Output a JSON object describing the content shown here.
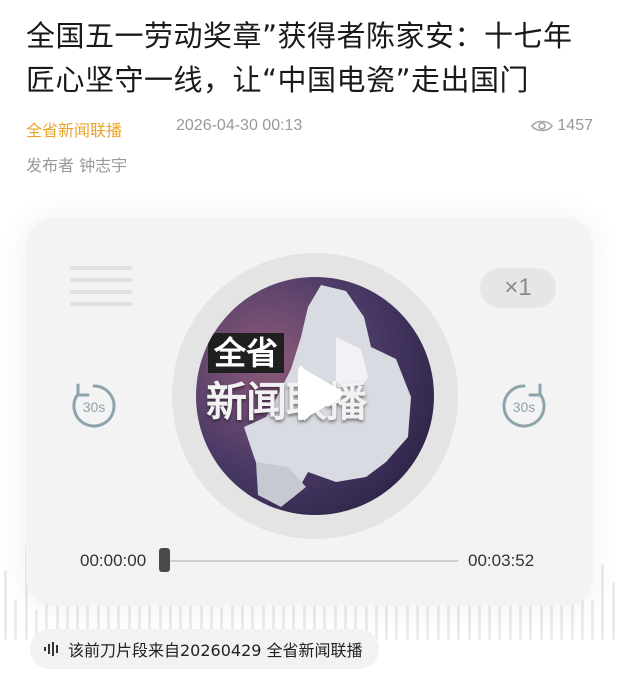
{
  "article": {
    "title": "全国五一劳动奖章”获得者陈家安：十七年匠心坚守一线，让“中国电瓷”走出国门",
    "source": "全省新闻联播",
    "time": "2026-04-30 00:13",
    "views": "1457",
    "publisher": "发布者 钟志宇"
  },
  "player": {
    "speed": "×1",
    "skip_back": "30s",
    "skip_forward": "30s",
    "cover_label_top": "全省",
    "cover_label_bottom": "新闻联播",
    "current_time": "00:00:00",
    "total_time": "00:03:52",
    "progress": 0
  },
  "clip_note": "该前刀片段来自20260429 全省新闻联播",
  "colors": {
    "source": "#e9a42a",
    "meta_gray": "#999999",
    "player_bg": "#f3f3f3",
    "icon_gray": "#8fa3ad"
  },
  "icons": [
    "eye-icon",
    "playlist-icon",
    "rewind-30-icon",
    "forward-30-icon",
    "play-icon",
    "audio-wave-icon"
  ]
}
